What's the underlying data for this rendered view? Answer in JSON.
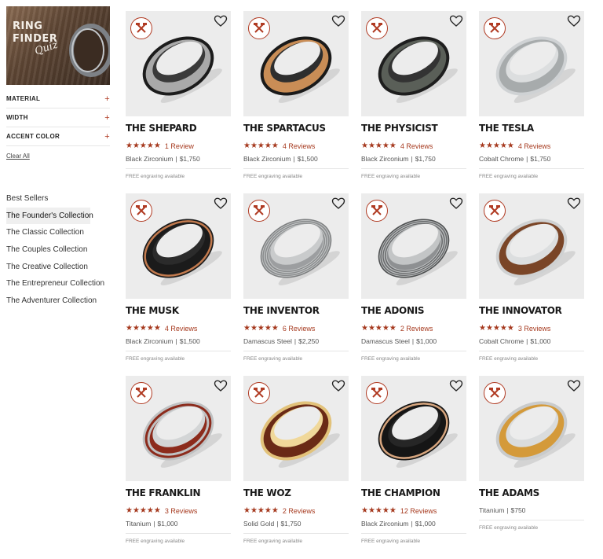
{
  "sidebar": {
    "banner": {
      "line1": "RING",
      "line2": "FINDER",
      "script": "Quiz"
    },
    "filters": [
      {
        "label": "MATERIAL",
        "icon": "plus-icon",
        "symbol": "+"
      },
      {
        "label": "WIDTH",
        "icon": "plus-icon",
        "symbol": "+"
      },
      {
        "label": "ACCENT COLOR",
        "icon": "plus-icon",
        "symbol": "+"
      }
    ],
    "clear_all": "Clear All",
    "collections": [
      {
        "label": "Best Sellers",
        "active": false
      },
      {
        "label": "The Founder's Collection",
        "active": true
      },
      {
        "label": "The Classic Collection",
        "active": false
      },
      {
        "label": "The Couples Collection",
        "active": false
      },
      {
        "label": "The Creative Collection",
        "active": false
      },
      {
        "label": "The Entrepreneur Collection",
        "active": false
      },
      {
        "label": "The Adventurer Collection",
        "active": false
      }
    ]
  },
  "products": [
    {
      "name": "THE SHEPARD",
      "stars": "★★★★★",
      "rating": 5,
      "reviews": "1 Review",
      "material": "Black Zirconium",
      "price": "$1,750",
      "engraving": "FREE engraving available",
      "ring": {
        "outer": "#1c1c1c",
        "inlay": "#a9a9a9",
        "inner": "#3a3a3a",
        "style": "wide-inlay"
      }
    },
    {
      "name": "THE SPARTACUS",
      "stars": "★★★★★",
      "rating": 4.5,
      "reviews": "4 Reviews",
      "material": "Black Zirconium",
      "price": "$1,500",
      "engraving": "FREE engraving available",
      "ring": {
        "outer": "#1a1a1a",
        "inlay": "#c98d56",
        "inner": "#2e2e2e",
        "style": "wide-inlay"
      }
    },
    {
      "name": "THE PHYSICIST",
      "stars": "★★★★★",
      "rating": 5,
      "reviews": "4 Reviews",
      "material": "Black Zirconium",
      "price": "$1,750",
      "engraving": "FREE engraving available",
      "ring": {
        "outer": "#1e1e1e",
        "inlay": "#5a5f58",
        "inner": "#333333",
        "style": "wide-inlay"
      }
    },
    {
      "name": "THE TESLA",
      "stars": "★★★★★",
      "rating": 5,
      "reviews": "4 Reviews",
      "material": "Cobalt Chrome",
      "price": "$1,750",
      "engraving": "FREE engraving available",
      "ring": {
        "outer": "#cfd2d4",
        "inlay": "#a7abac",
        "inner": "#dcdedf",
        "style": "wide-inlay"
      }
    },
    {
      "name": "THE MUSK",
      "stars": "★★★★★",
      "rating": 5,
      "reviews": "4 Reviews",
      "material": "Black Zirconium",
      "price": "$1,500",
      "engraving": "FREE engraving available",
      "ring": {
        "outer": "#1b1b1b",
        "inlay": "#c27a4e",
        "inner": "#2b2b2b",
        "style": "thin-stripe"
      }
    },
    {
      "name": "THE INVENTOR",
      "stars": "★★★★★",
      "rating": 5,
      "reviews": "6 Reviews",
      "material": "Damascus Steel",
      "price": "$2,250",
      "engraving": "FREE engraving available",
      "ring": {
        "outer": "#7d7f80",
        "inlay": "#9c9ea0",
        "inner": "#c9cbcc",
        "style": "damascus"
      }
    },
    {
      "name": "THE ADONIS",
      "stars": "★★★★★",
      "rating": 5,
      "reviews": "2 Reviews",
      "material": "Damascus Steel",
      "price": "$1,000",
      "engraving": "FREE engraving available",
      "ring": {
        "outer": "#4d4f50",
        "inlay": "#8e9092",
        "inner": "#c3c5c6",
        "style": "damascus"
      }
    },
    {
      "name": "THE INNOVATOR",
      "stars": "★★★★★",
      "rating": 5,
      "reviews": "3 Reviews",
      "material": "Cobalt Chrome",
      "price": "$1,000",
      "engraving": "FREE engraving available",
      "ring": {
        "outer": "#cfd1d2",
        "inlay": "#7a4527",
        "inner": "#dcdedf",
        "style": "wide-inlay"
      }
    },
    {
      "name": "THE FRANKLIN",
      "stars": "★★★★★",
      "rating": 4.5,
      "reviews": "3 Reviews",
      "material": "Titanium",
      "price": "$1,000",
      "engraving": "FREE engraving available",
      "ring": {
        "outer": "#bfc1c2",
        "inlay": "#8c2b1c",
        "inner": "#d3d5d6",
        "style": "double-stripe"
      }
    },
    {
      "name": "THE WOZ",
      "stars": "★★★★★",
      "rating": 5,
      "reviews": "2 Reviews",
      "material": "Solid Gold",
      "price": "$1,750",
      "engraving": "FREE engraving available",
      "ring": {
        "outer": "#e2c27a",
        "inlay": "#6a2a16",
        "inner": "#f0d89a",
        "style": "wide-inlay"
      }
    },
    {
      "name": "THE CHAMPION",
      "stars": "★★★★★",
      "rating": 5,
      "reviews": "12 Reviews",
      "material": "Black Zirconium",
      "price": "$1,000",
      "engraving": "FREE engraving available",
      "ring": {
        "outer": "#151515",
        "inlay": "#d6a57e",
        "inner": "#262626",
        "style": "thin-stripe"
      }
    },
    {
      "name": "THE ADAMS",
      "stars": "",
      "rating": 0,
      "reviews": "",
      "material": "Titanium",
      "price": "$750",
      "engraving": "FREE engraving available",
      "ring": {
        "outer": "#c9cbcc",
        "inlay": "#d49a3a",
        "inner": "#dadcdd",
        "style": "wide-inlay"
      }
    }
  ],
  "colors": {
    "accent": "#a63a1f",
    "card_bg": "#ececec"
  }
}
